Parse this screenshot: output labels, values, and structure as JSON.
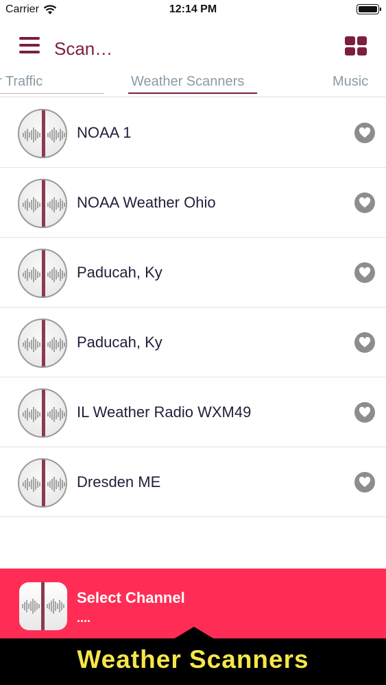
{
  "status": {
    "carrier": "Carrier",
    "time": "12:14 PM"
  },
  "nav": {
    "title": "Scan…"
  },
  "tabs": [
    {
      "label": "r Traffic"
    },
    {
      "label": "Weather Scanners"
    },
    {
      "label": "Music"
    }
  ],
  "channels": [
    {
      "name": "NOAA 1"
    },
    {
      "name": "NOAA Weather Ohio"
    },
    {
      "name": "Paducah, Ky"
    },
    {
      "name": "Paducah, Ky"
    },
    {
      "name": "IL Weather Radio WXM49"
    },
    {
      "name": "Dresden ME"
    }
  ],
  "player": {
    "title": "Select Channel",
    "subtitle": "...."
  },
  "banner": {
    "text": "Weather Scanners"
  },
  "colors": {
    "accent": "#7c1e3f",
    "player_bg": "#ff2d55",
    "banner_text": "#f5e64a"
  }
}
